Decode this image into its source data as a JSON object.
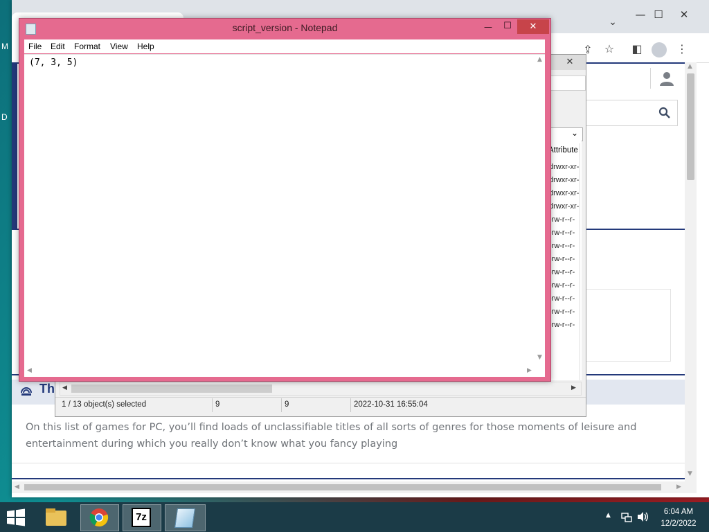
{
  "browser": {
    "page_body_text": "On this list of games for PC, you’ll find loads of unclassifiable titles of all sorts of genres for those moments of leisure and entertainment during which you really don’t know what you fancy playing",
    "section_heading_fragment": "Th",
    "left_edge_fragments": [
      "M",
      "D"
    ],
    "minimize_glyph": "—",
    "maximize_glyph": "☐",
    "close_glyph": "✕",
    "chevron_glyph": "⌄"
  },
  "file_manager": {
    "close_glyph": "✕",
    "column_header": "Attribute",
    "attributes": [
      "drwxr-xr-",
      "drwxr-xr-",
      "drwxr-xr-",
      "drwxr-xr-",
      "-rw-r--r-",
      "-rw-r--r-",
      "-rw-r--r-",
      "-rw-r--r-",
      "-rw-r--r-",
      "-rw-r--r-",
      "-rw-r--r-",
      "-rw-r--r-",
      "-rw-r--r-"
    ],
    "status": {
      "selection": "1 / 13 object(s) selected",
      "size": "9",
      "packed_size": "9",
      "modified": "2022-10-31 16:55:04"
    }
  },
  "notepad": {
    "title": "script_version - Notepad",
    "menu": [
      "File",
      "Edit",
      "Format",
      "View",
      "Help"
    ],
    "content": "(7, 3, 5)",
    "minimize_glyph": "—",
    "maximize_glyph": "☐",
    "close_glyph": "✕"
  },
  "taskbar": {
    "time": "6:04 AM",
    "date": "12/2/2022",
    "seven_zip_label": "7z"
  },
  "colors": {
    "notepad_frame": "#e56a8f",
    "close_red": "#c7444a",
    "navy": "#23397a",
    "taskbar": "#1b3b47"
  }
}
